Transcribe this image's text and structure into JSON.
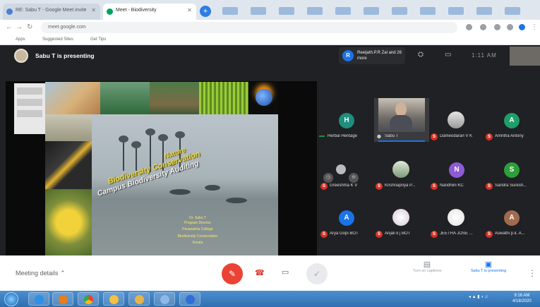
{
  "browser": {
    "tabs": [
      {
        "label": "RE: Sabu T - Google Meet invite",
        "favicon_color": "#4a7fd6"
      },
      {
        "label": "Meet - Biodiversity",
        "favicon_color": "#00a15e"
      }
    ],
    "new_tab": "+",
    "url": "meet.google.com",
    "bookmarks": [
      "Apps",
      "Suggested Sites",
      "Get Tips"
    ]
  },
  "meet": {
    "presenting_text": "Sabu T is presenting",
    "joined": {
      "avatar_letter": "R",
      "text": "Reeijath.P.R Zal and 26 more"
    },
    "clock": "1:11 AM"
  },
  "slide": {
    "title_nature": "Nature",
    "title_amp": "&",
    "title_biodiversity": "Biodiversity Conservation",
    "title_campus": "Campus Biodiversity Auditing",
    "author_lines": [
      "Dr. Sabu T",
      "Program Director",
      "Pavanatma College",
      "Biodiversity Conservation",
      "Kerala"
    ]
  },
  "participants": [
    {
      "name": "Herbal Heritage",
      "letter": "H",
      "color": "#1e8e7e",
      "type": "avatar"
    },
    {
      "name": "Sabu T",
      "type": "video"
    },
    {
      "name": "Dameodaran V K",
      "type": "photo"
    },
    {
      "name": "Amritha Antony",
      "letter": "A",
      "color": "#1e9e6a",
      "type": "avatar"
    },
    {
      "name": "Greeshma K V",
      "type": "hover"
    },
    {
      "name": "Krishnapriya P...",
      "type": "photo"
    },
    {
      "name": "Nandhini KC",
      "letter": "N",
      "color": "#8e5bd6",
      "type": "avatar"
    },
    {
      "name": "Sandra Suresh...",
      "letter": "S",
      "color": "#2e9e3a",
      "type": "avatar"
    },
    {
      "name": "Arya Gopi BOT",
      "letter": "A",
      "color": "#1a73e8",
      "type": "avatar"
    },
    {
      "name": "Anjali k j BOT",
      "type": "photo"
    },
    {
      "name": "JEETHA JOSE ...",
      "type": "photo"
    },
    {
      "name": "Aswathi p.k. A...",
      "letter": "A",
      "color": "#a06a4e",
      "type": "avatar"
    }
  ],
  "controls": {
    "meeting_details": "Meeting details",
    "present_now": "Turn on captions",
    "presenting": "Sabu T is presenting",
    "end_call_icon": "phone-end-icon",
    "more": "⋮"
  },
  "taskbar": {
    "time": "9:16 AM",
    "date": "4/18/2020"
  }
}
